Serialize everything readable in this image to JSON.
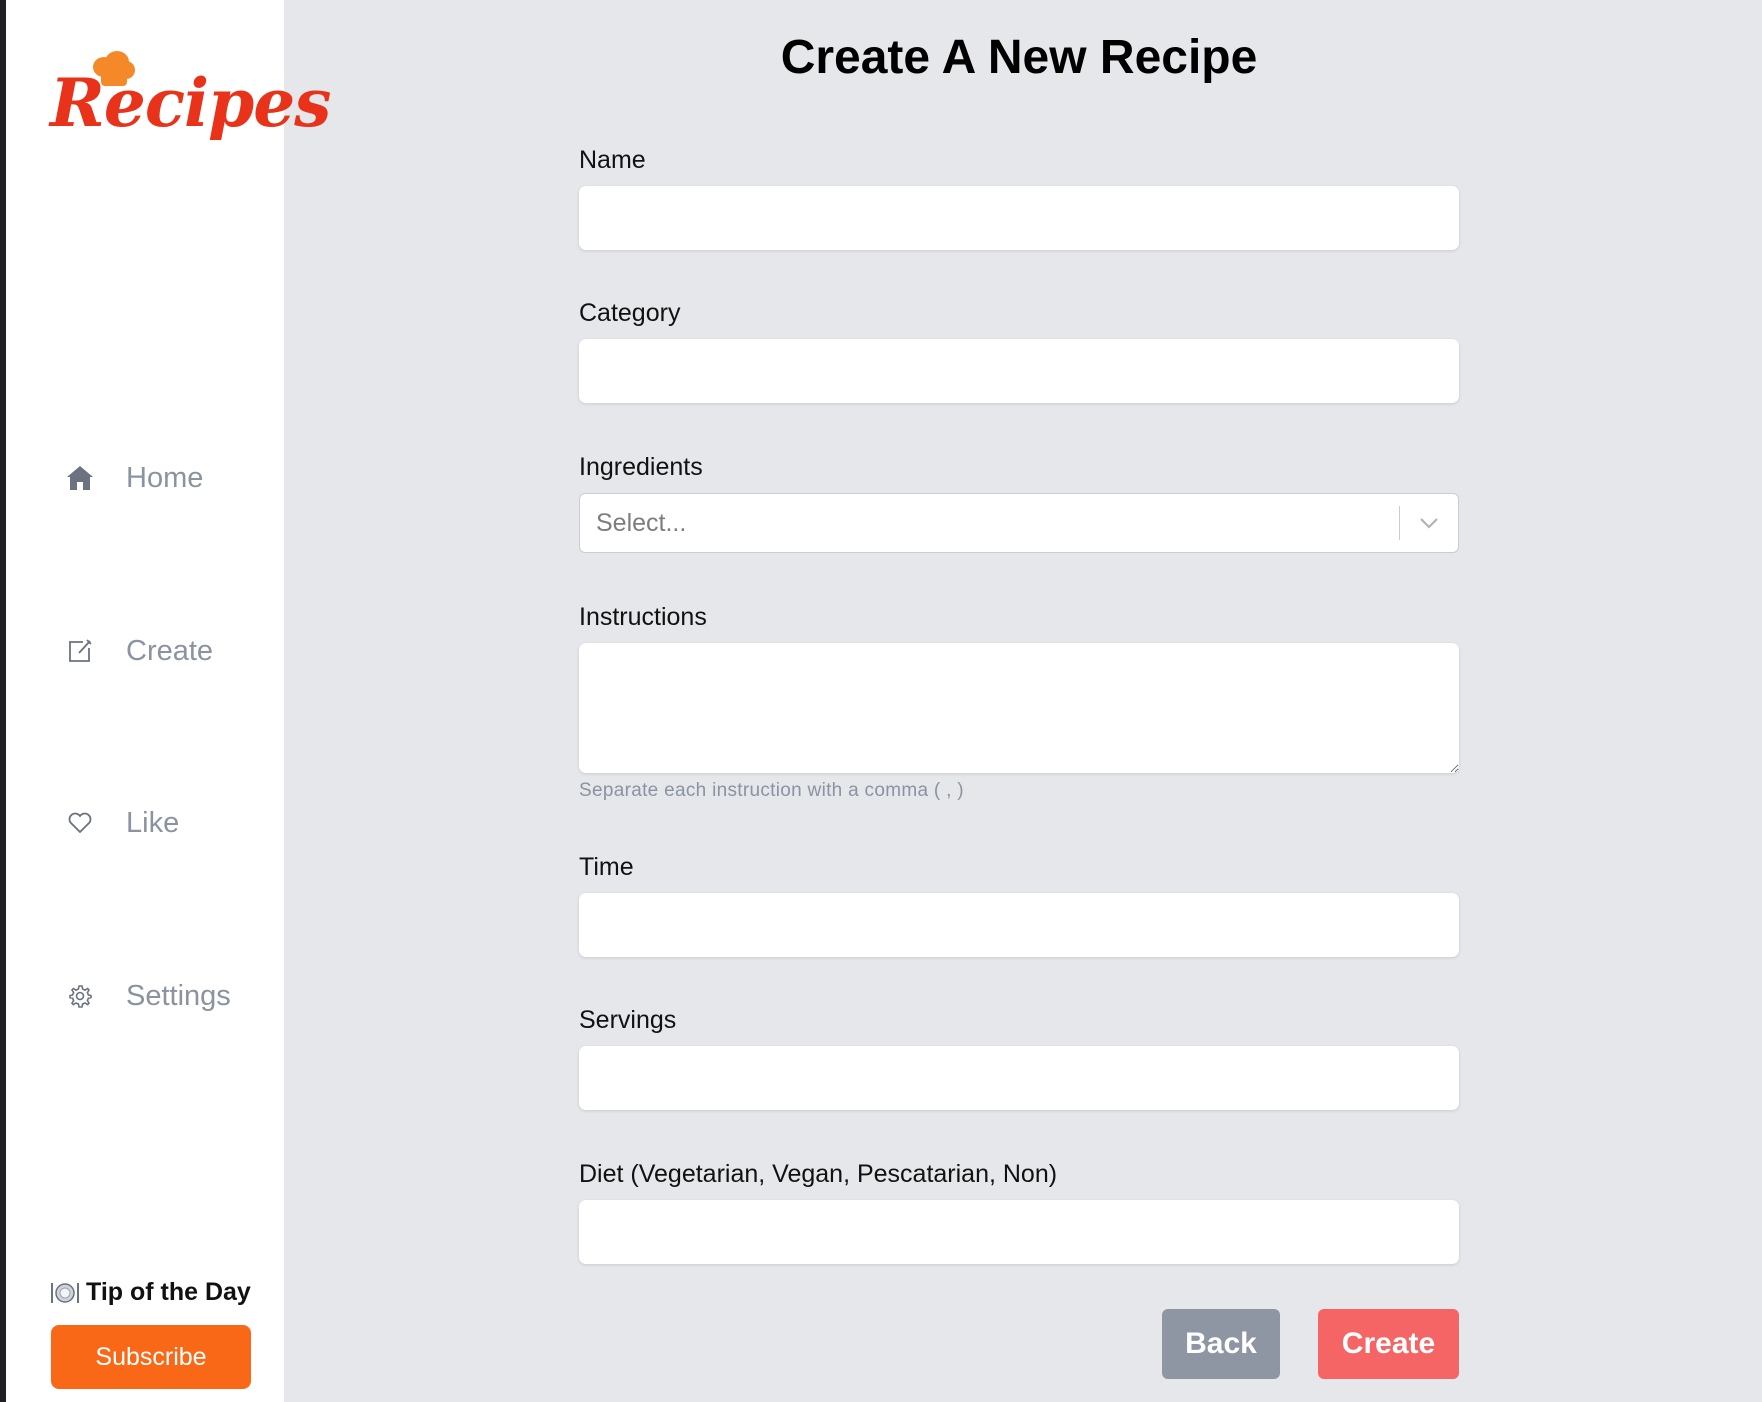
{
  "brand": {
    "logo_text": "Recipes",
    "accent_color": "#e8321a",
    "hat_color": "#f5892a"
  },
  "sidebar": {
    "items": [
      {
        "label": "Home",
        "icon": "home-icon"
      },
      {
        "label": "Create",
        "icon": "edit-icon"
      },
      {
        "label": "Like",
        "icon": "heart-icon"
      },
      {
        "label": "Settings",
        "icon": "gear-icon"
      }
    ],
    "tip_label": "Tip of the Day",
    "tip_icon": "plate-cutlery-icon",
    "subscribe_label": "Subscribe",
    "subscribe_color": "#f96816"
  },
  "form": {
    "title": "Create A New Recipe",
    "fields": {
      "name": {
        "label": "Name",
        "value": ""
      },
      "category": {
        "label": "Category",
        "value": ""
      },
      "ingredients": {
        "label": "Ingredients",
        "placeholder": "Select..."
      },
      "instructions": {
        "label": "Instructions",
        "value": "",
        "helper": "Separate each instruction with a comma ( , )"
      },
      "time": {
        "label": "Time",
        "value": ""
      },
      "servings": {
        "label": "Servings",
        "value": ""
      },
      "diet": {
        "label": "Diet (Vegetarian, Vegan, Pescatarian, Non)",
        "value": ""
      }
    },
    "buttons": {
      "back_label": "Back",
      "back_color": "#8f96a3",
      "create_label": "Create",
      "create_color": "#f56565"
    }
  }
}
